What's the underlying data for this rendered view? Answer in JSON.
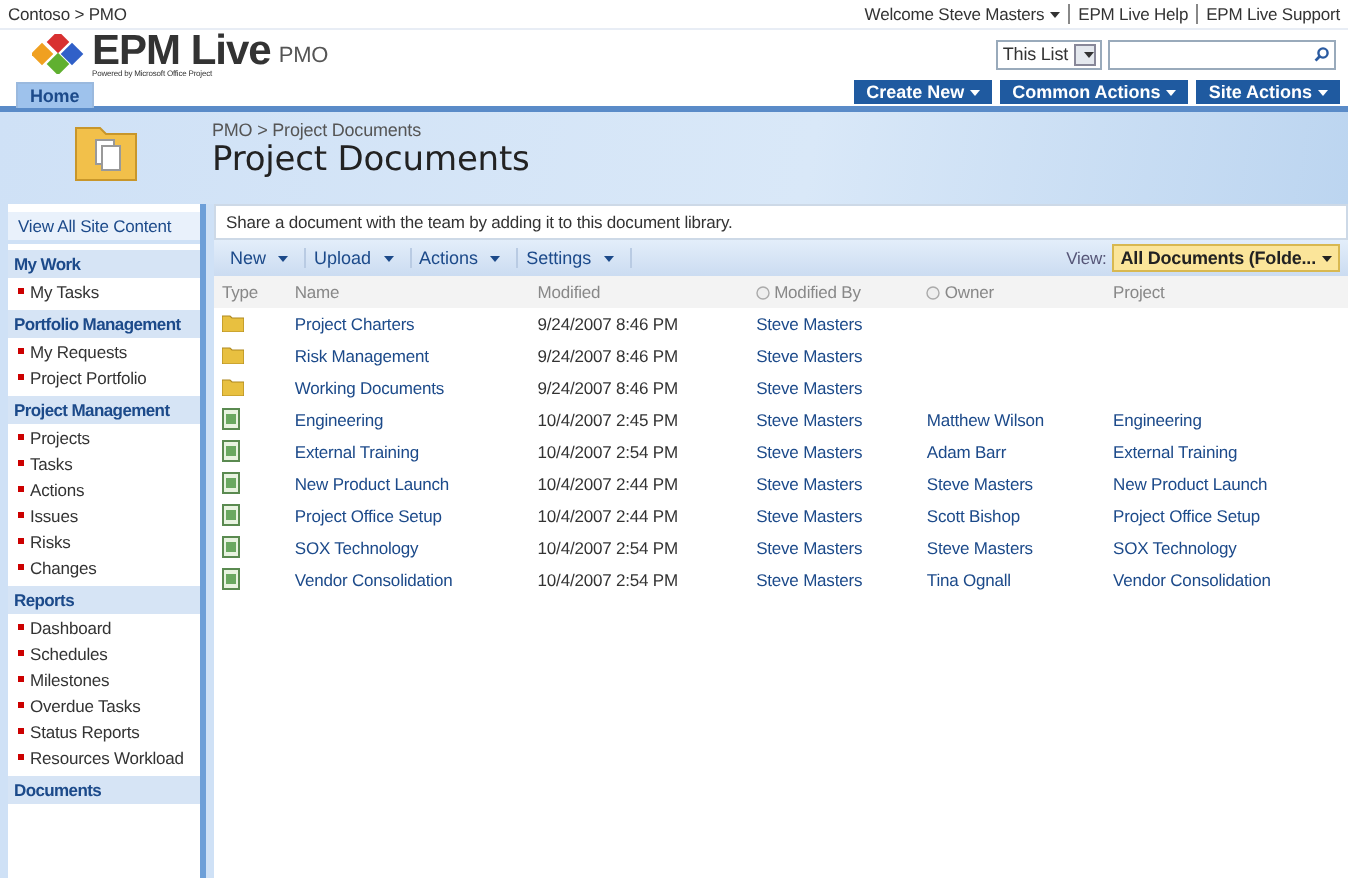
{
  "top_bar": {
    "breadcrumb": "Contoso > PMO",
    "welcome": "Welcome Steve Masters",
    "links": [
      "EPM Live Help",
      "EPM Live Support"
    ]
  },
  "logo": {
    "name": "EPM Live",
    "tagline": "Powered by Microsoft Office Project",
    "site": "PMO"
  },
  "search": {
    "scope": "This List"
  },
  "tabs": [
    {
      "label": "Home",
      "selected": true
    }
  ],
  "action_menus": [
    "Create New",
    "Common Actions",
    "Site Actions"
  ],
  "page": {
    "breadcrumb": "PMO > Project Documents",
    "title": "Project Documents"
  },
  "sidebar": {
    "top_link": "View All Site Content",
    "sections": [
      {
        "title": "My Work",
        "items": [
          "My Tasks"
        ]
      },
      {
        "title": "Portfolio Management",
        "items": [
          "My Requests",
          "Project Portfolio"
        ]
      },
      {
        "title": "Project Management",
        "items": [
          "Projects",
          "Tasks",
          "Actions",
          "Issues",
          "Risks",
          "Changes"
        ]
      },
      {
        "title": "Reports",
        "items": [
          "Dashboard",
          "Schedules",
          "Milestones",
          "Overdue Tasks",
          "Status Reports",
          "Resources Workload"
        ]
      },
      {
        "title": "Documents"
      }
    ]
  },
  "library": {
    "description": "Share a document with the team by adding it to this document library.",
    "toolbar": [
      {
        "label": "New",
        "split": true
      },
      {
        "label": "Upload",
        "split": true
      },
      {
        "label": "Actions",
        "split": false
      },
      {
        "label": "Settings",
        "split": false
      }
    ],
    "view_label": "View:",
    "view": "All Documents (Folde...",
    "columns": [
      {
        "label": "Type",
        "sort_icon": false
      },
      {
        "label": "Name",
        "sort_icon": false
      },
      {
        "label": "Modified",
        "sort_icon": false
      },
      {
        "label": "Modified By",
        "sort_icon": true
      },
      {
        "label": "Owner",
        "sort_icon": true
      },
      {
        "label": "Project",
        "sort_icon": false
      }
    ],
    "rows": [
      {
        "kind": "folder",
        "name": "Project Charters",
        "modified": "9/24/2007 8:46 PM",
        "modified_by": "Steve Masters"
      },
      {
        "kind": "folder",
        "name": "Risk Management",
        "modified": "9/24/2007 8:46 PM",
        "modified_by": "Steve Masters"
      },
      {
        "kind": "folder",
        "name": "Working Documents",
        "modified": "9/24/2007 8:46 PM",
        "modified_by": "Steve Masters"
      },
      {
        "kind": "document",
        "name": "Engineering",
        "modified": "10/4/2007 2:45 PM",
        "modified_by": "Steve Masters",
        "owner": "Matthew Wilson",
        "project": "Engineering"
      },
      {
        "kind": "document",
        "name": "External Training",
        "modified": "10/4/2007 2:54 PM",
        "modified_by": "Steve Masters",
        "owner": "Adam Barr",
        "project": "External Training"
      },
      {
        "kind": "document",
        "name": "New Product Launch",
        "modified": "10/4/2007 2:44 PM",
        "modified_by": "Steve Masters",
        "owner": "Steve Masters",
        "project": "New Product Launch"
      },
      {
        "kind": "document",
        "name": "Project Office Setup",
        "modified": "10/4/2007 2:44 PM",
        "modified_by": "Steve Masters",
        "owner": "Scott Bishop",
        "project": "Project Office Setup"
      },
      {
        "kind": "document",
        "name": "SOX Technology",
        "modified": "10/4/2007 2:54 PM",
        "modified_by": "Steve Masters",
        "owner": "Steve Masters",
        "project": "SOX Technology"
      },
      {
        "kind": "document",
        "name": "Vendor Consolidation",
        "modified": "10/4/2007 2:54 PM",
        "modified_by": "Steve Masters",
        "owner": "Tina Ognall",
        "project": "Vendor Consolidation"
      }
    ]
  }
}
